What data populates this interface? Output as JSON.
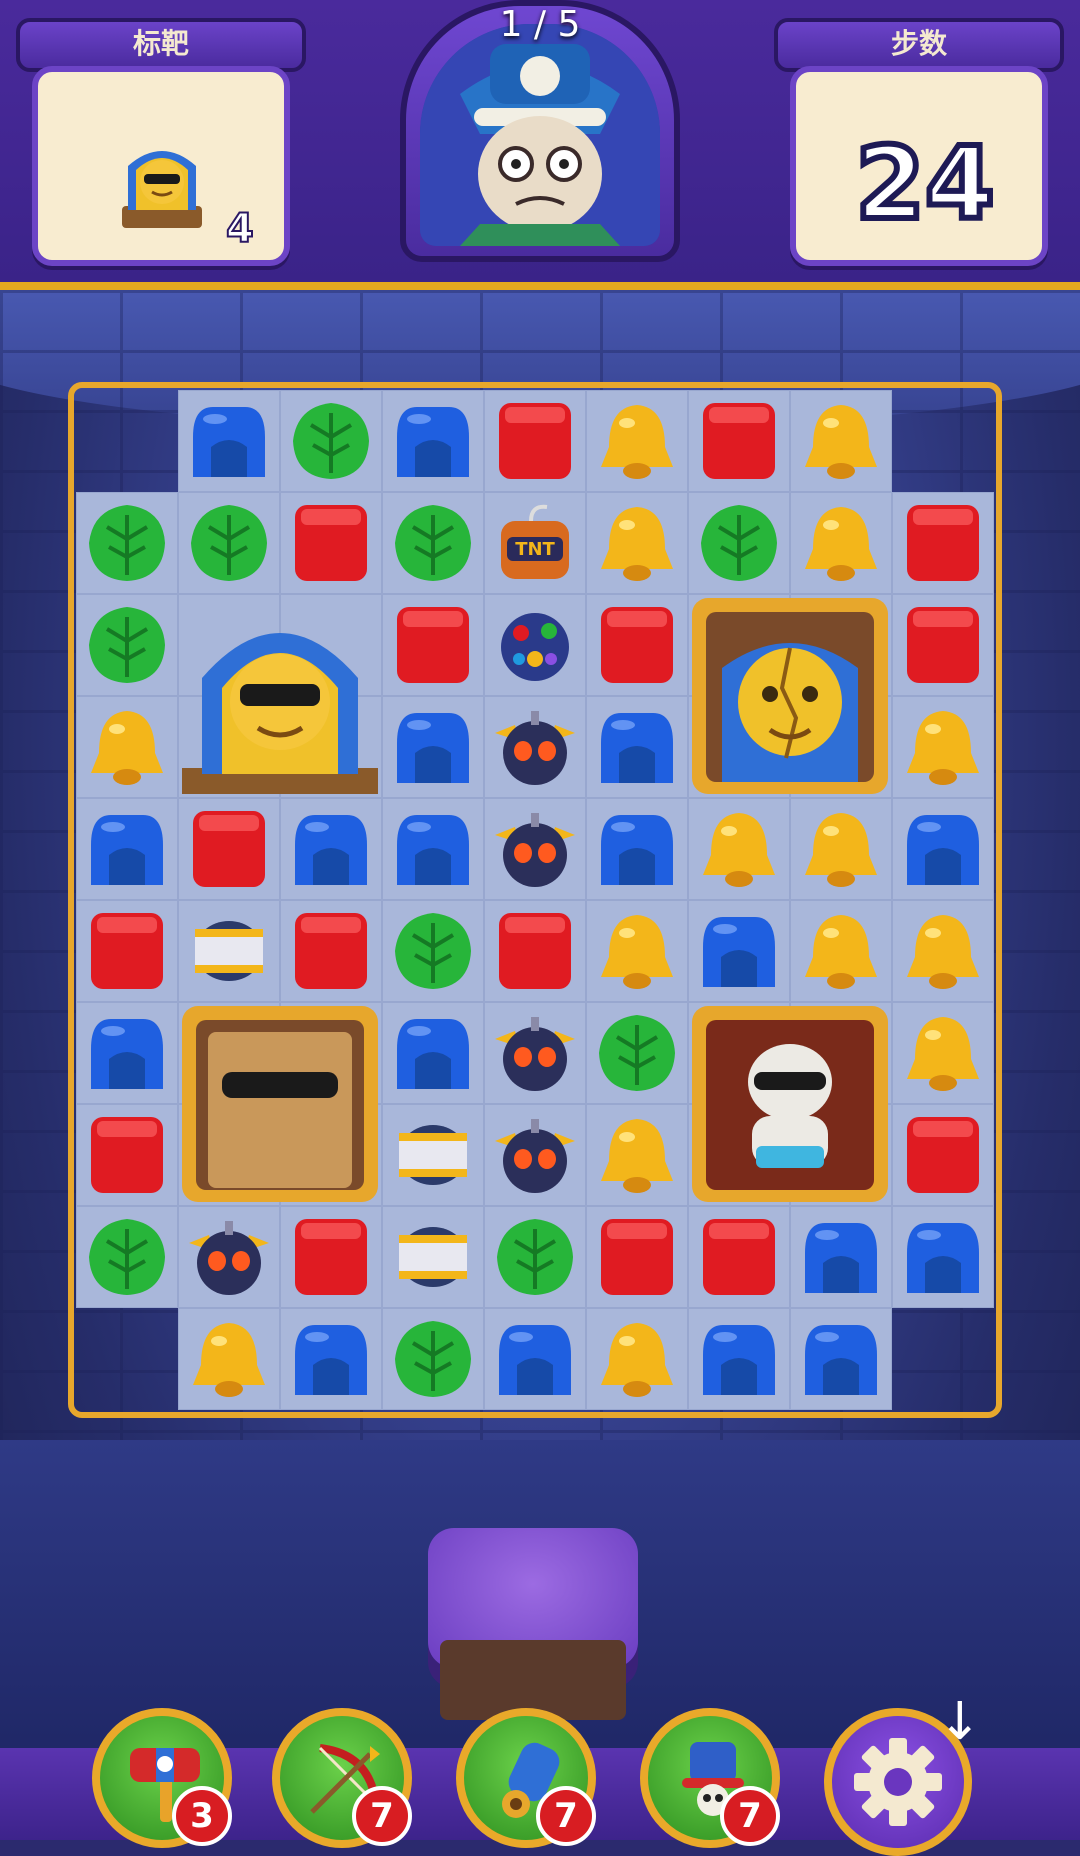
{
  "header": {
    "page_indicator": "1 / 5",
    "goal_label": "标靶",
    "goal_count": "4",
    "moves_label": "步数",
    "moves_value": "24"
  },
  "board": {
    "cols": 9,
    "rows": 10,
    "legend": {
      "B": "blue-glove",
      "G": "green-leaf",
      "R": "red-block",
      "Y": "yellow-bell",
      "T": "tnt-barrel",
      "D": "disco-bomb",
      "O": "bat-bomb",
      "S": "silver-rocket",
      "X": "large-tile",
      "_": "empty"
    },
    "grid": [
      "_BGBRYRY_",
      "GGRGTYGYR",
      "GXXRDRXXR",
      "YXXBOBXXY",
      "BRBBOBYYB",
      "RSRGRYBYY",
      "BXXBOGXXY",
      "RXXSOYXXR",
      "GORSGRRBB",
      "_YBGBYBB_"
    ],
    "large_tiles": [
      {
        "name": "pharaoh-sarcophagus",
        "style": "pharaoh"
      },
      {
        "name": "cracked-golden-statue",
        "style": "cracked"
      },
      {
        "name": "sand-block-with-sunglasses",
        "style": "sand"
      },
      {
        "name": "mummy-with-sunglasses",
        "style": "mummy"
      }
    ]
  },
  "boosters": [
    {
      "name": "hammer",
      "count": "3"
    },
    {
      "name": "bow-arrow",
      "count": "7"
    },
    {
      "name": "cannon",
      "count": "7"
    },
    {
      "name": "skull-hat",
      "count": "7"
    }
  ],
  "colors": {
    "blue": "#1f5fe0",
    "green": "#27b53a",
    "red": "#e01b22",
    "yellow": "#f3b61a",
    "frame": "#e7a72c"
  }
}
